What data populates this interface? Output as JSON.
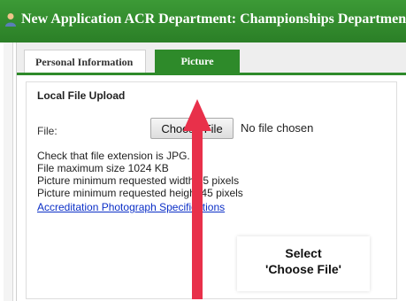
{
  "window": {
    "title": "New Application ACR Department: Championships Department",
    "icon": "user-icon",
    "accent_color": "#2e8a2a"
  },
  "tabs": [
    {
      "label": "Personal Information",
      "selected": false
    },
    {
      "label": "Picture",
      "selected": true
    }
  ],
  "upload": {
    "section_title": "Local File Upload",
    "file_label": "File:",
    "button_label": "Choose File",
    "status": "No file chosen"
  },
  "requirements": [
    "Check that file extension is JPG.",
    "File maximum size 1024 KB",
    "Picture minimum requested width 45 pixels",
    "Picture minimum requested height 45 pixels"
  ],
  "spec_link": "Accreditation Photograph Specifications",
  "callout": {
    "line1": "Select",
    "line2": "'Choose File'",
    "arrow_color": "#e8304a"
  }
}
